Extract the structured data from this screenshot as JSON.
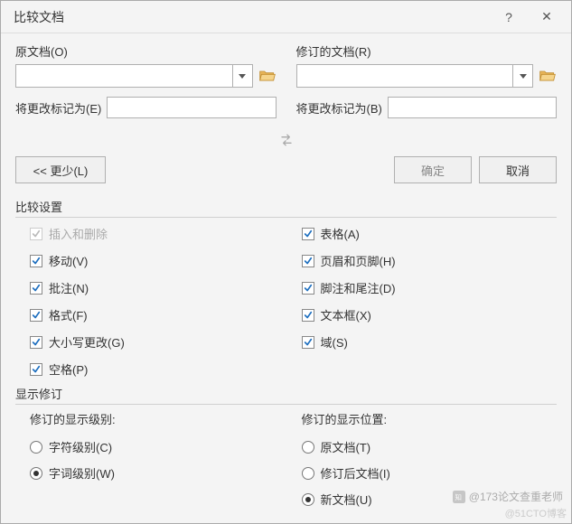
{
  "titlebar": {
    "title": "比较文档",
    "help": "?",
    "close": "✕"
  },
  "docs": {
    "original": {
      "label": "原文档(O)",
      "markas": "将更改标记为(E)"
    },
    "revised": {
      "label": "修订的文档(R)",
      "markas": "将更改标记为(B)"
    }
  },
  "buttons": {
    "less": "<< 更少(L)",
    "ok": "确定",
    "cancel": "取消"
  },
  "compare": {
    "header": "比较设置",
    "left": [
      {
        "label": "插入和删除",
        "checked": true,
        "disabled": true
      },
      {
        "label": "移动(V)",
        "checked": true,
        "disabled": false
      },
      {
        "label": "批注(N)",
        "checked": true,
        "disabled": false
      },
      {
        "label": "格式(F)",
        "checked": true,
        "disabled": false
      },
      {
        "label": "大小写更改(G)",
        "checked": true,
        "disabled": false
      },
      {
        "label": "空格(P)",
        "checked": true,
        "disabled": false
      }
    ],
    "right": [
      {
        "label": "表格(A)",
        "checked": true,
        "disabled": false
      },
      {
        "label": "页眉和页脚(H)",
        "checked": true,
        "disabled": false
      },
      {
        "label": "脚注和尾注(D)",
        "checked": true,
        "disabled": false
      },
      {
        "label": "文本框(X)",
        "checked": true,
        "disabled": false
      },
      {
        "label": "域(S)",
        "checked": true,
        "disabled": false
      }
    ]
  },
  "show": {
    "header": "显示修订",
    "levelLabel": "修订的显示级别:",
    "levels": [
      {
        "label": "字符级别(C)",
        "selected": false
      },
      {
        "label": "字词级别(W)",
        "selected": true
      }
    ],
    "posLabel": "修订的显示位置:",
    "positions": [
      {
        "label": "原文档(T)",
        "selected": false
      },
      {
        "label": "修订后文档(I)",
        "selected": false
      },
      {
        "label": "新文档(U)",
        "selected": true
      }
    ]
  },
  "watermark": "@173论文查重老师",
  "watermark2": "@51CTO博客"
}
